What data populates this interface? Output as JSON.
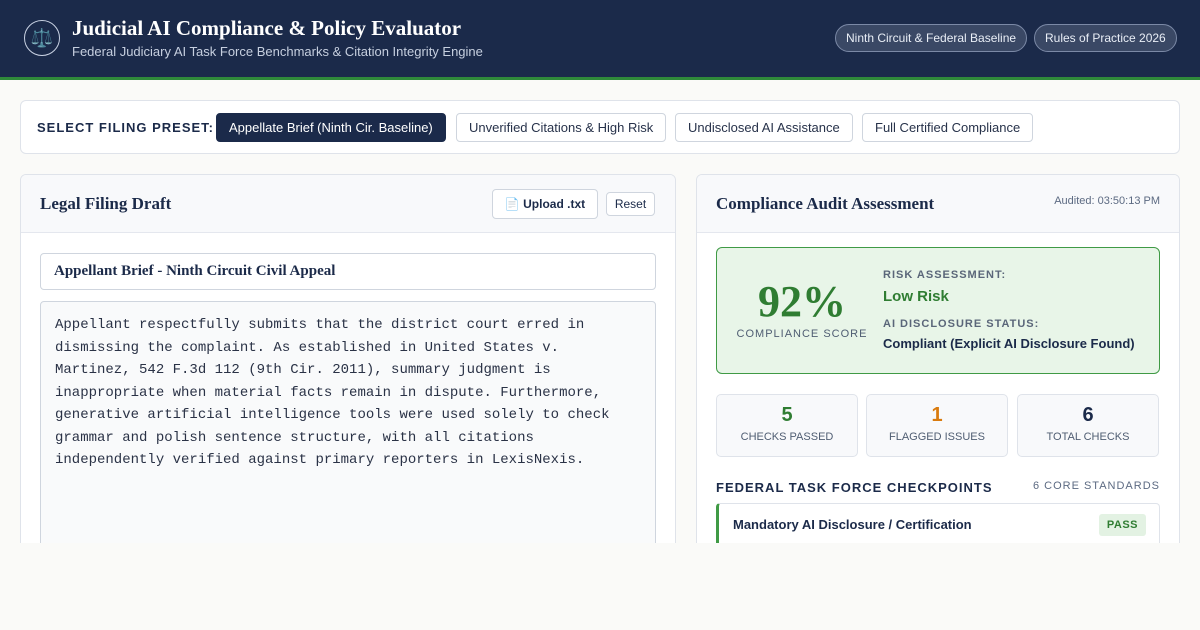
{
  "header": {
    "logo_glyph": "⚖️",
    "title": "Judicial AI Compliance & Policy Evaluator",
    "subtitle": "Federal Judiciary AI Task Force Benchmarks & Citation Integrity Engine",
    "badges": [
      "Ninth Circuit & Federal Baseline",
      "Rules of Practice 2026"
    ]
  },
  "presets": {
    "label": "SELECT FILING PRESET:",
    "items": [
      "Appellate Brief (Ninth Cir. Baseline)",
      "Unverified Citations & High Risk",
      "Undisclosed AI Assistance",
      "Full Certified Compliance"
    ],
    "active_index": 0
  },
  "draft": {
    "title": "Legal Filing Draft",
    "upload_label": "📄 Upload .txt",
    "reset_label": "Reset",
    "doc_title": "Appellant Brief - Ninth Circuit Civil Appeal",
    "body": "Appellant respectfully submits that the district court erred in\ndismissing the complaint. As established in United States v.\nMartinez, 542 F.3d 112 (9th Cir. 2011), summary judgment is\ninappropriate when material facts remain in dispute. Furthermore,\ngenerative artificial intelligence tools were used solely to check\ngrammar and polish sentence structure, with all citations\nindependently verified against primary reporters in LexisNexis."
  },
  "audit": {
    "title": "Compliance Audit Assessment",
    "timestamp": "Audited: 03:50:13 PM",
    "score": "92%",
    "score_label": "COMPLIANCE SCORE",
    "risk_label": "RISK ASSESSMENT:",
    "risk_value": "Low Risk",
    "disclosure_label": "AI DISCLOSURE STATUS:",
    "disclosure_value": "Compliant (Explicit AI Disclosure Found)",
    "stats": [
      {
        "value": "5",
        "label": "CHECKS PASSED",
        "color": "#2f7d32"
      },
      {
        "value": "1",
        "label": "FLAGGED ISSUES",
        "color": "#d97b0e"
      },
      {
        "value": "6",
        "label": "TOTAL CHECKS",
        "color": "#1b2a49"
      }
    ],
    "checkpoints_title": "FEDERAL TASK FORCE CHECKPOINTS",
    "checkpoints_count": "6 CORE STANDARDS",
    "checkpoints": [
      {
        "name": "Mandatory AI Disclosure / Certification",
        "status": "PASS"
      }
    ]
  }
}
